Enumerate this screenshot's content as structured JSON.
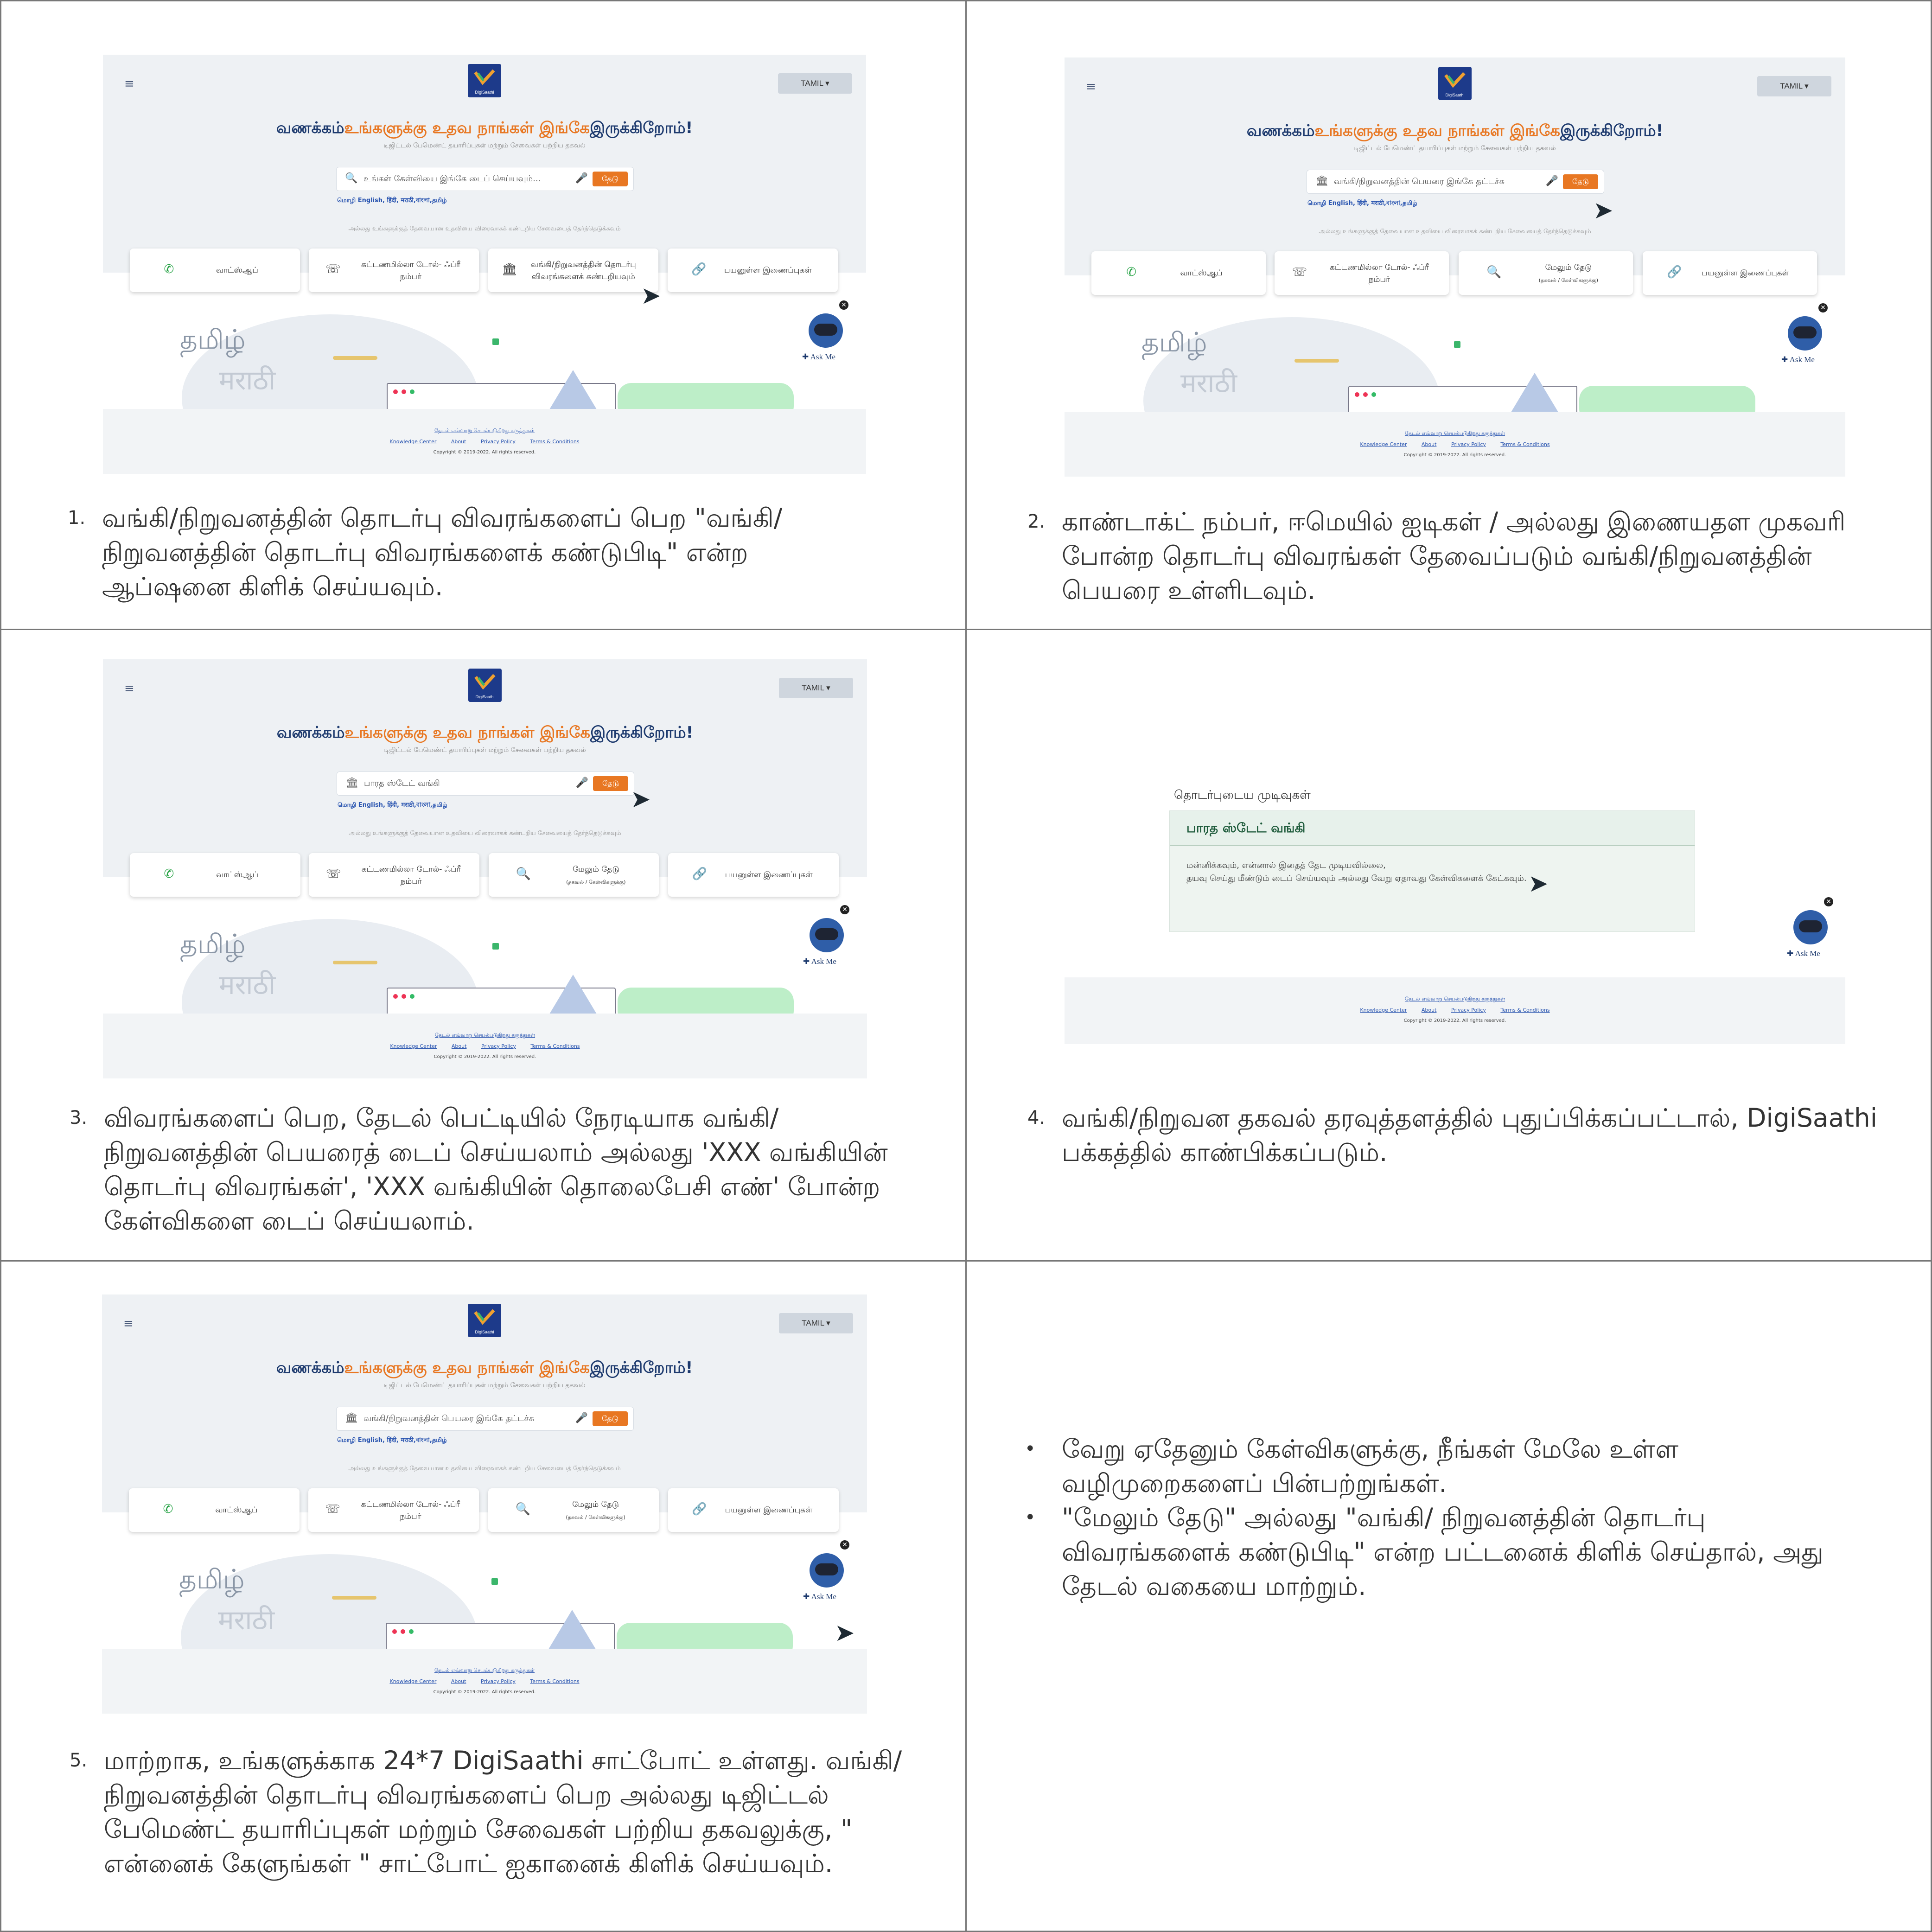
{
  "app": {
    "brand": "DigiSaathi",
    "language_button": "TAMIL ▾",
    "headline_a": "வணக்கம்",
    "headline_b": "உங்களுக்கு உதவ நாங்கள் இங்கே",
    "headline_c": "இருக்கிறோம்!",
    "subtitle": "டிஜிட்டல் பேமெண்ட் தயாரிப்புகள் மற்றும் சேவைகள் பற்றிய தகவல்",
    "search_button": "தேடு",
    "lang_line": "மொழி English, हिंदी, मराठी,বাংলা,தமிழ்",
    "hint": "அல்லது உங்களுக்குத் தேவையான உதவியை விரைவாகக் கண்டறிய சேவையைத் தேர்ந்தெடுக்கவும்",
    "card_whatsapp": "வாட்ஸ்ஆப்",
    "card_tollfree": "கட்டணமில்லா டோல்- ஃப்ரீ நம்பர்",
    "card_find_contact": "வங்கி/நிறுவனத்தின் தொடர்பு விவரங்களைக் கண்டறியவும்",
    "card_search_more": "மேலும் தேடு",
    "card_search_more_sub": "(தகவல் / கேள்விகளுக்கு)",
    "card_links": "பயனுள்ள இணைப்புகள்",
    "illus_tamil": "தமிழ்",
    "illus_marathi": "मराठी",
    "ask_me": "Ask Me",
    "footer_links_top": "தேடல் எவ்வாறு செயல்படுகிறது    கருத்துகள்",
    "footer_knowledge": "Knowledge Center",
    "footer_about": "About",
    "footer_privacy": "Privacy Policy",
    "footer_terms": "Terms & Conditions",
    "footer_copyright": "Copyright © 2019-2022. All rights reserved.",
    "placeholder_default": "உங்கள் கேள்வியை இங்கே டைப் செய்யவும்...",
    "placeholder_bank": "வங்கி/நிறுவனத்தின் பெயரை இங்கே தட்டச்சு",
    "typed_query": "பாரத ஸ்டேட் வங்கி"
  },
  "results": {
    "title": "தொடர்புடைய முடிவுகள்",
    "bank": "பாரத ஸ்டேட் வங்கி",
    "msg1": "மன்னிக்கவும், என்னால் இதைத் தேட முடியவில்லை,",
    "msg2": "தயவு செய்து மீண்டும் டைப் செய்யவும் அல்லது வேறு ஏதாவது கேள்விகளைக் கேட்கவும்."
  },
  "captions": {
    "n1": "1.",
    "c1": "வங்கி/நிறுவனத்தின் தொடர்பு விவரங்களைப் பெற \"வங்கி/நிறுவனத்தின் தொடர்பு விவரங்களைக் கண்டுபிடி\" என்ற ஆப்ஷனை கிளிக் செய்யவும்.",
    "n2": "2.",
    "c2": "காண்டாக்ட் நம்பர், ஈமெயில் ஐடிகள் / அல்லது இணையதள முகவரி போன்ற தொடர்பு விவரங்கள் தேவைப்படும் வங்கி/நிறுவனத்தின் பெயரை உள்ளிடவும்.",
    "n3": "3.",
    "c3": "விவரங்களைப் பெற, தேடல் பெட்டியில் நேரடியாக வங்கி/நிறுவனத்தின் பெயரைத் டைப் செய்யலாம் அல்லது 'XXX வங்கியின் தொடர்பு விவரங்கள்', 'XXX வங்கியின் தொலைபேசி எண்' போன்ற கேள்விகளை டைப் செய்யலாம்.",
    "n4": "4.",
    "c4": "வங்கி/நிறுவன தகவல் தரவுத்தளத்தில் புதுப்பிக்கப்பட்டால், DigiSaathi பக்கத்தில் காண்பிக்கப்படும்.",
    "n5": "5.",
    "c5": "மாற்றாக, உங்களுக்காக 24*7 DigiSaathi சாட்போட் உள்ளது. வங்கி/நிறுவனத்தின் தொடர்பு விவரங்களைப் பெற அல்லது டிஜிட்டல் பேமெண்ட் தயாரிப்புகள் மற்றும் சேவைகள் பற்றிய தகவலுக்கு, \" என்னைக் கேளுங்கள் \" சாட்போட் ஐகானைக் கிளிக் செய்யவும்.",
    "b1": "வேறு ஏதேனும் கேள்விகளுக்கு, நீங்கள் மேலே உள்ள வழிமுறைகளைப் பின்பற்றுங்கள்.",
    "b2": "\"மேலும் தேடு\" அல்லது \"வங்கி/ நிறுவனத்தின் தொடர்பு விவரங்களைக் கண்டுபிடி\" என்ற பட்டனைக் கிளிக் செய்தால், அது தேடல் வகையை மாற்றும்."
  },
  "colors": {
    "accent": "#e87722",
    "navy": "#1d3a6e",
    "whatsapp": "#25a244"
  }
}
